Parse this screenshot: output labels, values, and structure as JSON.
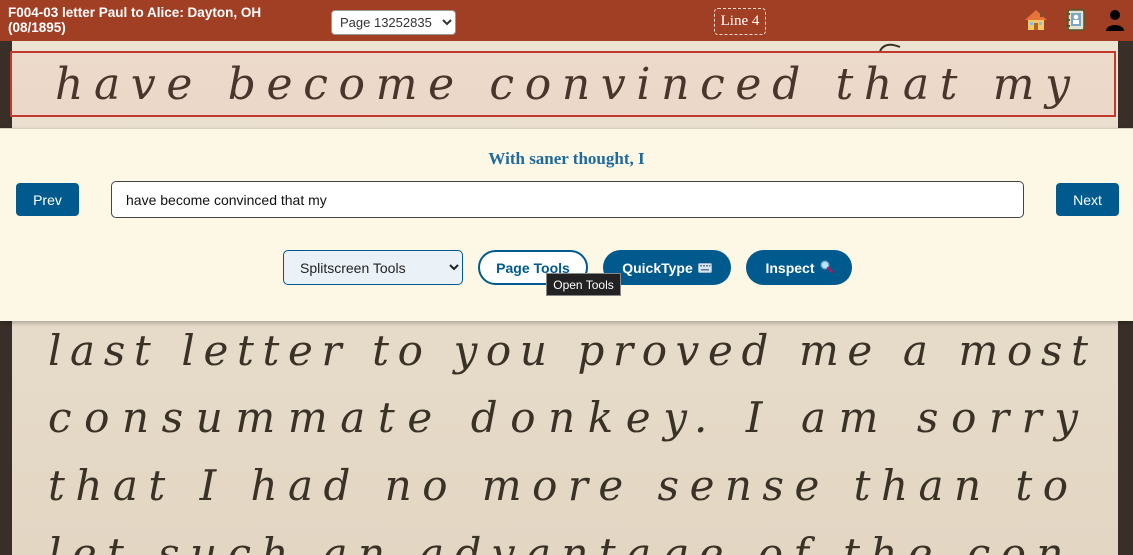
{
  "header": {
    "document_title": "F004-03 letter Paul to Alice: Dayton, OH (08/1895)",
    "page_select_value": "Page 13252835",
    "line_indicator": "Line 4",
    "icons": [
      "home-icon",
      "contacts-book-icon",
      "user-icon"
    ]
  },
  "manuscript": {
    "active_line": "have become convinced that my",
    "lines_below": [
      "last letter to you proved me a most",
      "consummate donkey.      I am sorry",
      "that I had no more sense than to",
      "let such an advantage of the con-"
    ]
  },
  "panel": {
    "previous_line": "With saner thought, I",
    "prev_label": "Prev",
    "next_label": "Next",
    "transcription_value": "have become convinced that my",
    "splitscreen_value": "Splitscreen Tools",
    "page_tools_label": "Page Tools",
    "quicktype_label": "QuickType",
    "inspect_label": "Inspect",
    "tooltip": "Open Tools",
    "icons": [
      "keyboard-icon",
      "magnifier-icon"
    ]
  },
  "colors": {
    "topbar": "#a13f24",
    "accent": "#005a8d",
    "panel_bg": "#fdf7e6",
    "highlight": "#c0392b"
  }
}
